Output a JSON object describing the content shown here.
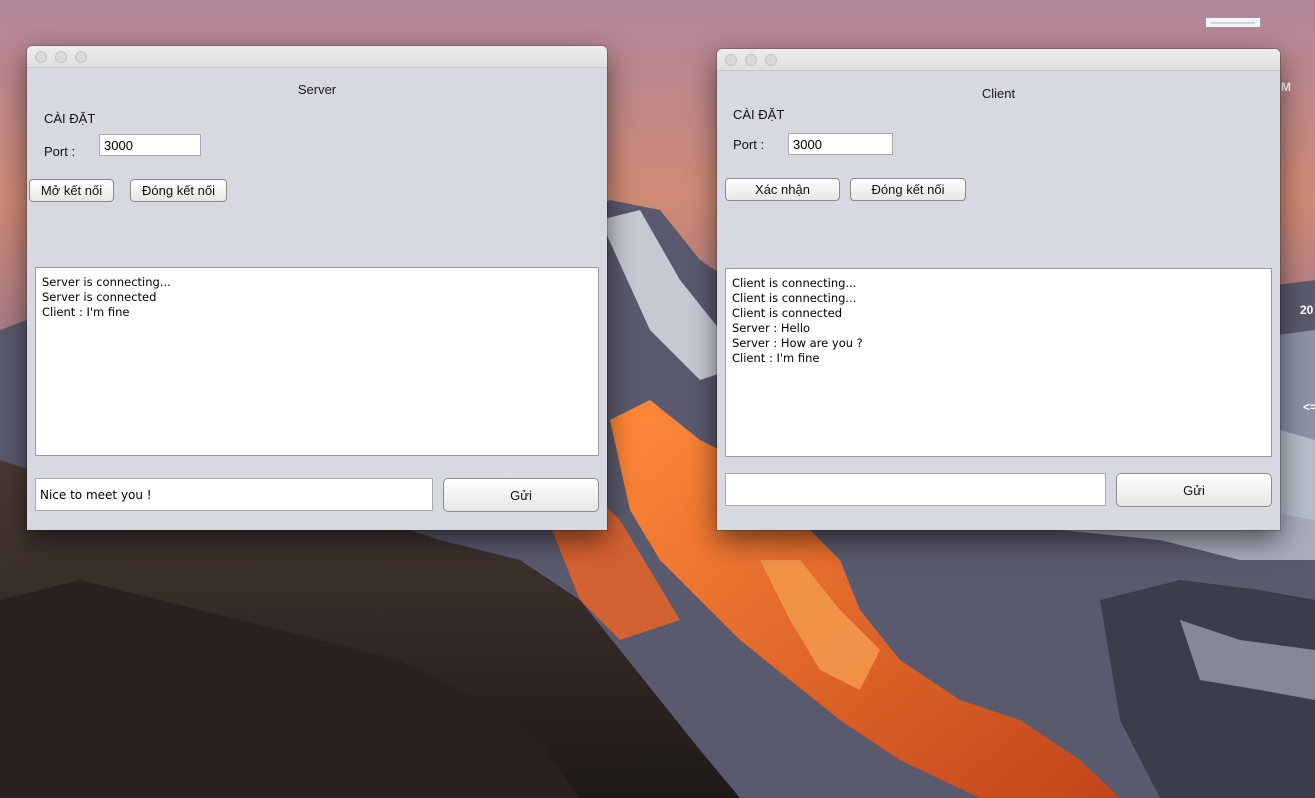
{
  "desktop": {
    "edge_texts": [
      "M",
      "20",
      "<="
    ]
  },
  "server_window": {
    "title": "Server",
    "section_label": "CÀI ĐẶT",
    "port_label": "Port :",
    "port_value": "3000",
    "open_button": "Mở kết nối",
    "close_button": "Đóng kết nối",
    "log": [
      "Server is connecting...",
      "Server is connected",
      "Client : I'm fine"
    ],
    "message_value": "Nice to meet you !",
    "send_button": "Gửi"
  },
  "client_window": {
    "title": "Client",
    "section_label": "CÀI ĐẶT",
    "port_label": "Port :",
    "port_value": "3000",
    "confirm_button": "Xác nhận",
    "close_button": "Đóng kết nối",
    "log": [
      "Client is connecting...",
      "Client is connecting...",
      "Client is connected",
      "Server : Hello",
      "Server : How are you ?",
      "Client : I'm fine"
    ],
    "message_value": "",
    "send_button": "Gửi"
  }
}
